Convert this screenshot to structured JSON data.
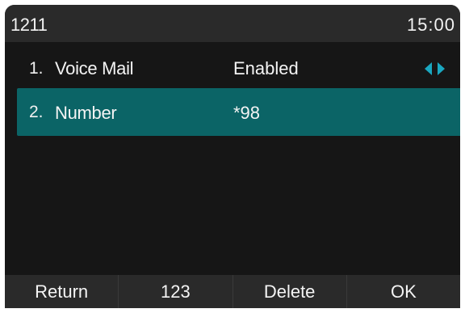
{
  "status_bar": {
    "account": "1211",
    "time": "15:00"
  },
  "rows": [
    {
      "index": "1.",
      "label": "Voice Mail",
      "value": "Enabled",
      "icons": [
        "arrow-left-icon",
        "arrow-right-icon"
      ]
    },
    {
      "index": "2.",
      "label": "Number",
      "value": "*98",
      "selected": true
    }
  ],
  "softkeys": [
    "Return",
    "123",
    "Delete",
    "OK"
  ],
  "colors": {
    "background": "#161616",
    "bar": "#2a2a2a",
    "selection": "#0b6466",
    "arrow": "#1aa7c0",
    "text": "#f4f4f4"
  }
}
